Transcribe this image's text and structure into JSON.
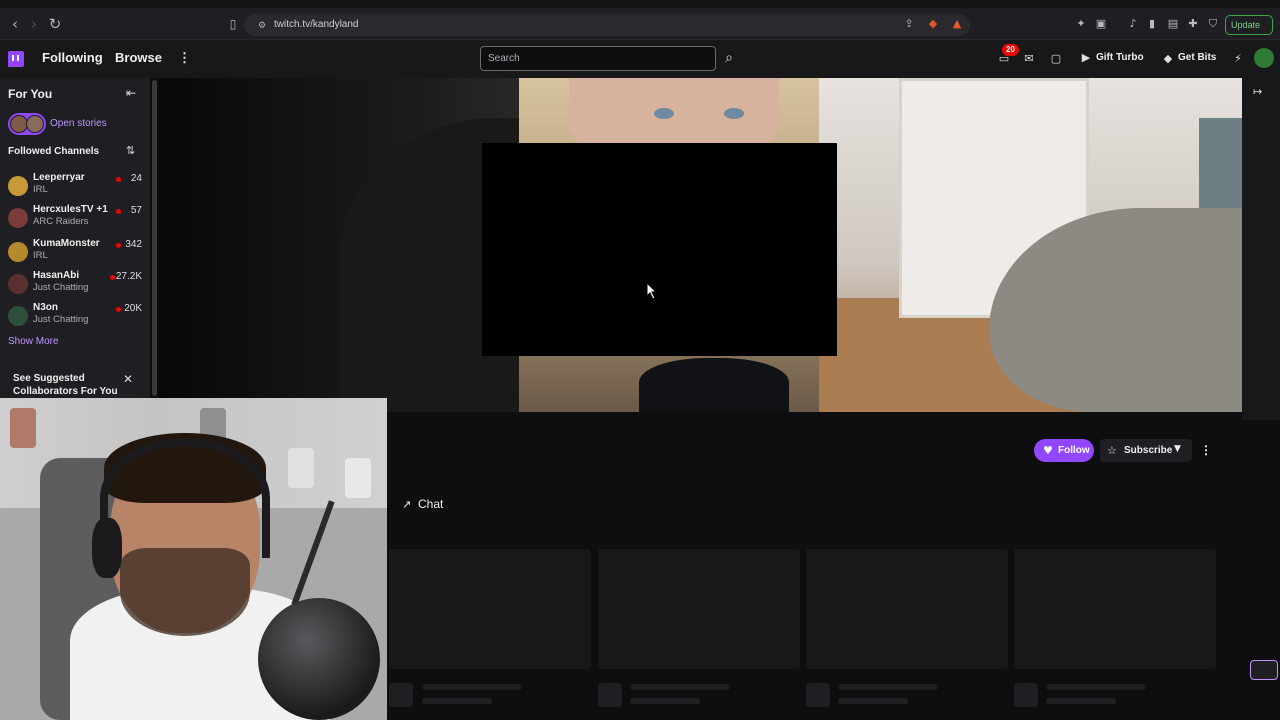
{
  "browser": {
    "url": "twitch.tv/kandyland",
    "update_label": "Update"
  },
  "topnav": {
    "following": "Following",
    "browse": "Browse",
    "search_placeholder": "Search",
    "notif_count": "20",
    "gift_turbo": "Gift Turbo",
    "get_bits": "Get Bits"
  },
  "sidebar": {
    "for_you": "For You",
    "open_stories": "Open stories",
    "followed_channels": "Followed Channels",
    "channels": [
      {
        "name": "Leeperryar",
        "game": "IRL",
        "viewers": "24",
        "color": "#c89a3a"
      },
      {
        "name": "HercxulesTV +1",
        "game": "ARC Raiders",
        "viewers": "57",
        "color": "#7a3b3b"
      },
      {
        "name": "KumaMonster",
        "game": "IRL",
        "viewers": "342",
        "color": "#b58a2c"
      },
      {
        "name": "HasanAbi",
        "game": "Just Chatting",
        "viewers": "27.2K",
        "color": "#5a2f2f"
      },
      {
        "name": "N3on",
        "game": "Just Chatting",
        "viewers": "20K",
        "color": "#2f4f3a"
      }
    ],
    "show_more": "Show More",
    "suggest": "See Suggested Collaborators For You"
  },
  "channel": {
    "follow": "Follow",
    "subscribe": "Subscribe",
    "chat": "Chat"
  },
  "colors": {
    "accent": "#9147ff",
    "live": "#eb0400",
    "bg": "#0e0e10"
  }
}
